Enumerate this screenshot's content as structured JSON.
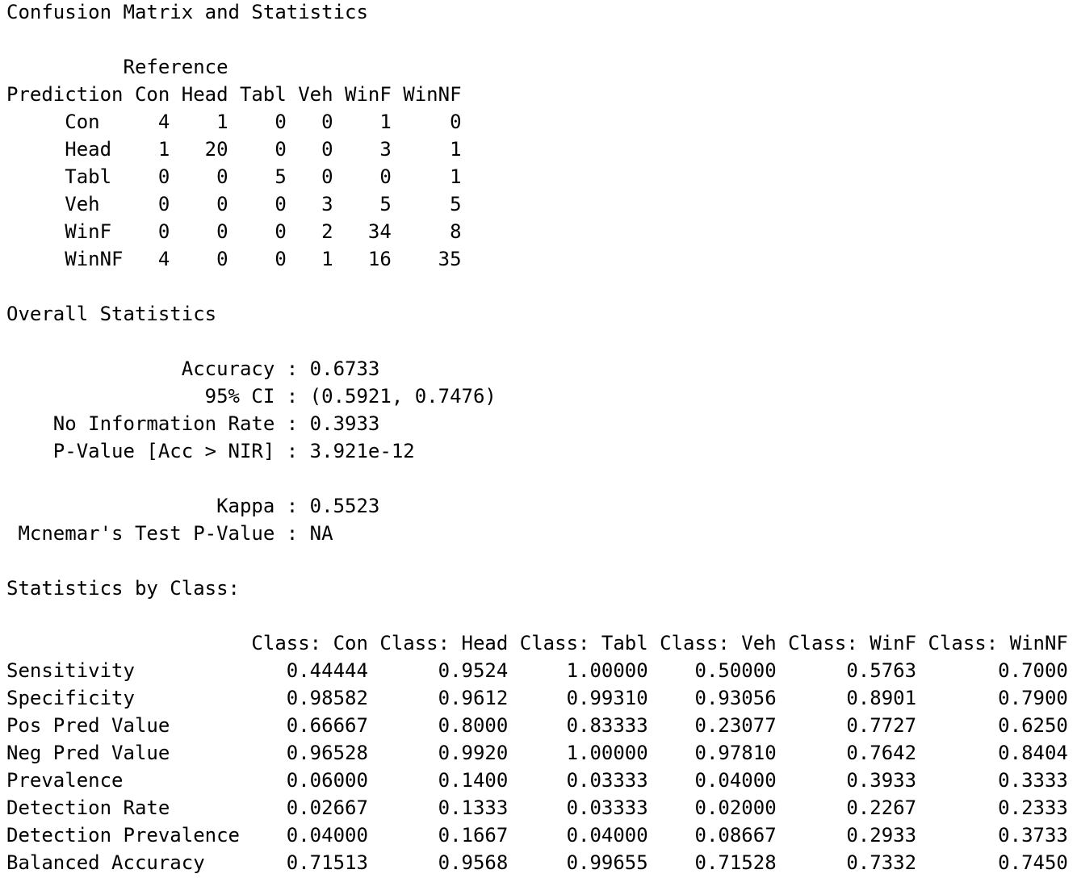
{
  "output_lines": [
    "Confusion Matrix and Statistics",
    "",
    "          Reference",
    "Prediction Con Head Tabl Veh WinF WinNF",
    "     Con     4    1    0   0    1     0",
    "     Head    1   20    0   0    3     1",
    "     Tabl    0    0    5   0    0     1",
    "     Veh     0    0    0   3    5     5",
    "     WinF    0    0    0   2   34     8",
    "     WinNF   4    0    0   1   16    35",
    "",
    "Overall Statistics",
    "",
    "               Accuracy : 0.6733",
    "                 95% CI : (0.5921, 0.7476)",
    "    No Information Rate : 0.3933",
    "    P-Value [Acc > NIR] : 3.921e-12",
    "",
    "                  Kappa : 0.5523",
    " Mcnemar's Test P-Value : NA",
    "",
    "Statistics by Class:",
    "",
    "                     Class: Con Class: Head Class: Tabl Class: Veh Class: WinF Class: WinNF",
    "Sensitivity             0.44444      0.9524     1.00000    0.50000      0.5763       0.7000",
    "Specificity             0.98582      0.9612     0.99310    0.93056      0.8901       0.7900",
    "Pos Pred Value          0.66667      0.8000     0.83333    0.23077      0.7727       0.6250",
    "Neg Pred Value          0.96528      0.9920     1.00000    0.97810      0.7642       0.8404",
    "Prevalence              0.06000      0.1400     0.03333    0.04000      0.3933       0.3333",
    "Detection Rate          0.02667      0.1333     0.03333    0.02000      0.2267       0.2333",
    "Detection Prevalence    0.04000      0.1667     0.04000    0.08667      0.2933       0.3733",
    "Balanced Accuracy       0.71513      0.9568     0.99655    0.71528      0.7332       0.7450"
  ]
}
